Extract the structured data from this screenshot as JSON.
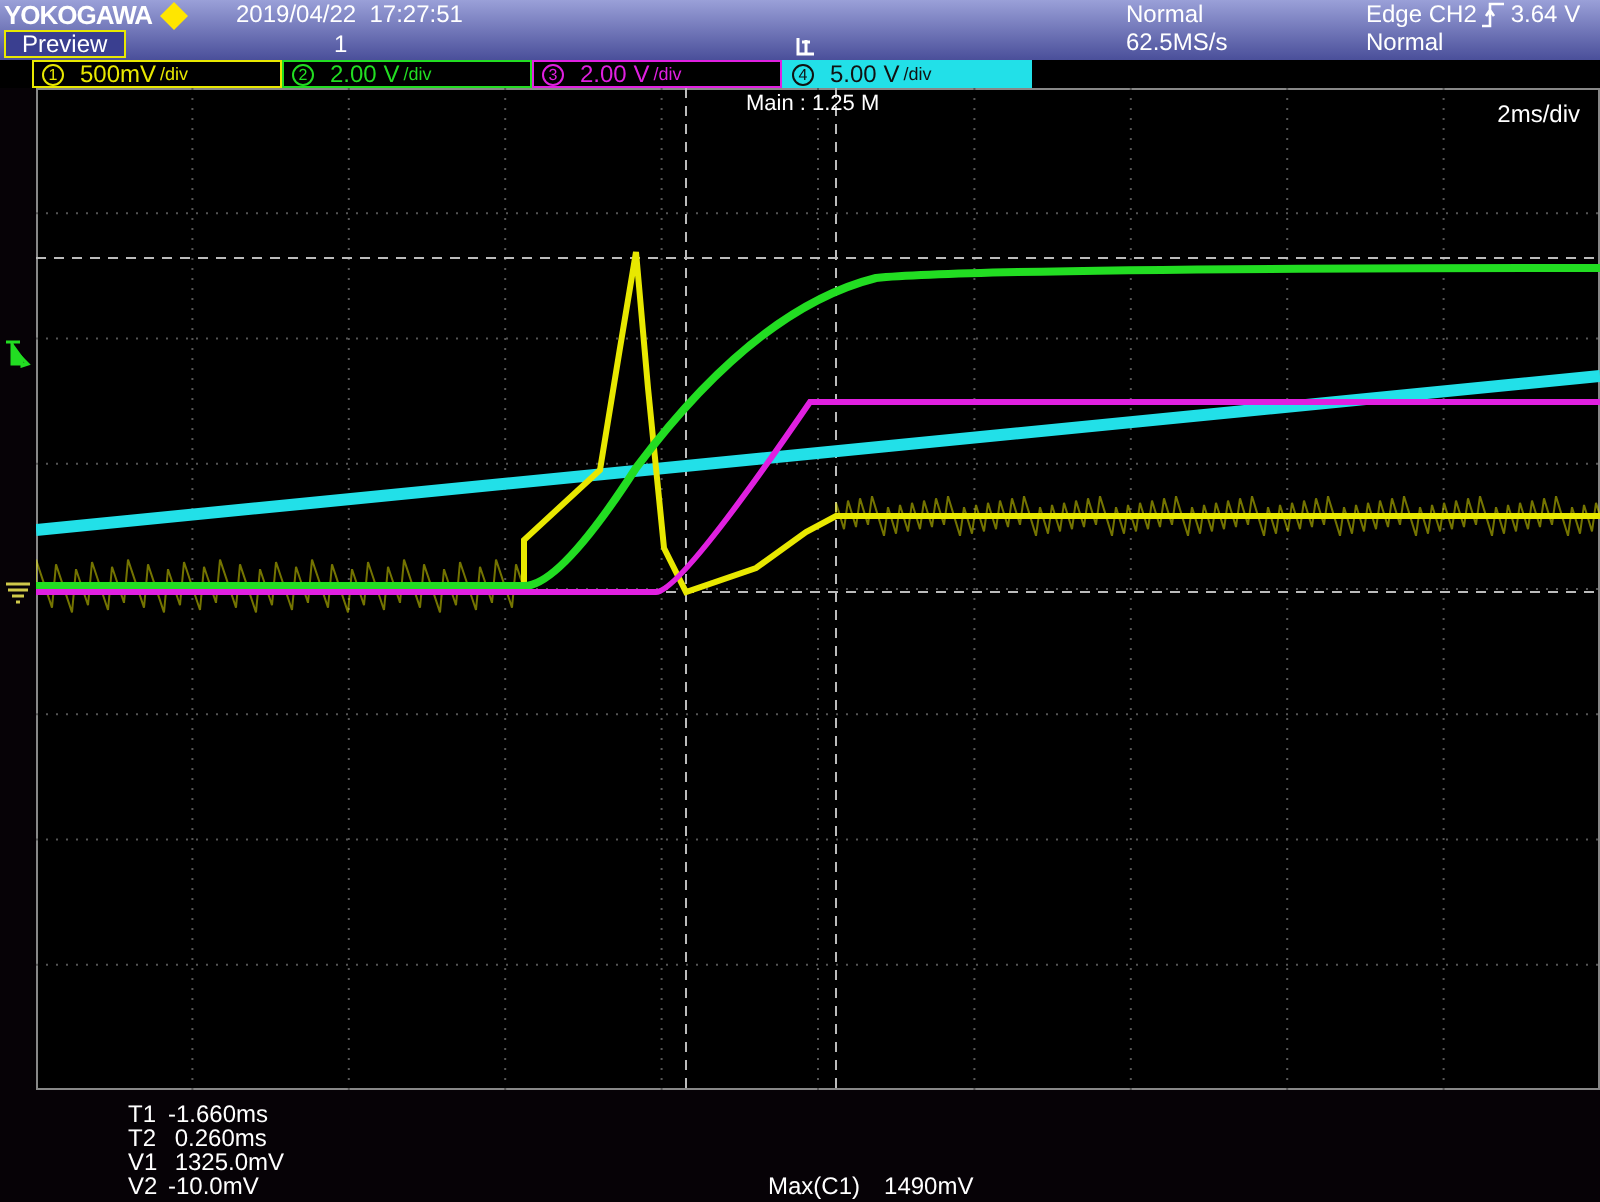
{
  "header": {
    "brand": "YOKOGAWA",
    "mode_badge": "Preview",
    "datetime": "2019/04/22  17:27:51",
    "record_number": "1",
    "acquisition": {
      "mode": "Normal",
      "sample_rate": "62.5MS/s"
    },
    "trigger": {
      "source": "Edge CH2",
      "level": "3.64 V",
      "mode": "Normal"
    }
  },
  "channels": [
    {
      "number": "1",
      "scale": "500mV",
      "unit": "/div",
      "color": "#e8e800",
      "selected": false
    },
    {
      "number": "2",
      "scale": "2.00 V",
      "unit": "/div",
      "color": "#22dd22",
      "selected": false
    },
    {
      "number": "3",
      "scale": "2.00 V",
      "unit": "/div",
      "color": "#e020e0",
      "selected": false
    },
    {
      "number": "4",
      "scale": "5.00 V",
      "unit": "/div",
      "color": "#22e0e8",
      "selected": true
    }
  ],
  "display": {
    "zoom_label": "Main : 1.25 M",
    "timebase": "2ms/div"
  },
  "cursors": [
    {
      "label": "T1",
      "value": "-1.660ms"
    },
    {
      "label": "T2",
      "value": " 0.260ms"
    },
    {
      "label": "V1",
      "value": " 1325.0mV"
    },
    {
      "label": "V2",
      "value": "-10.0mV"
    }
  ],
  "measurement": {
    "label": "Max(C1)",
    "value": "1490mV"
  }
}
